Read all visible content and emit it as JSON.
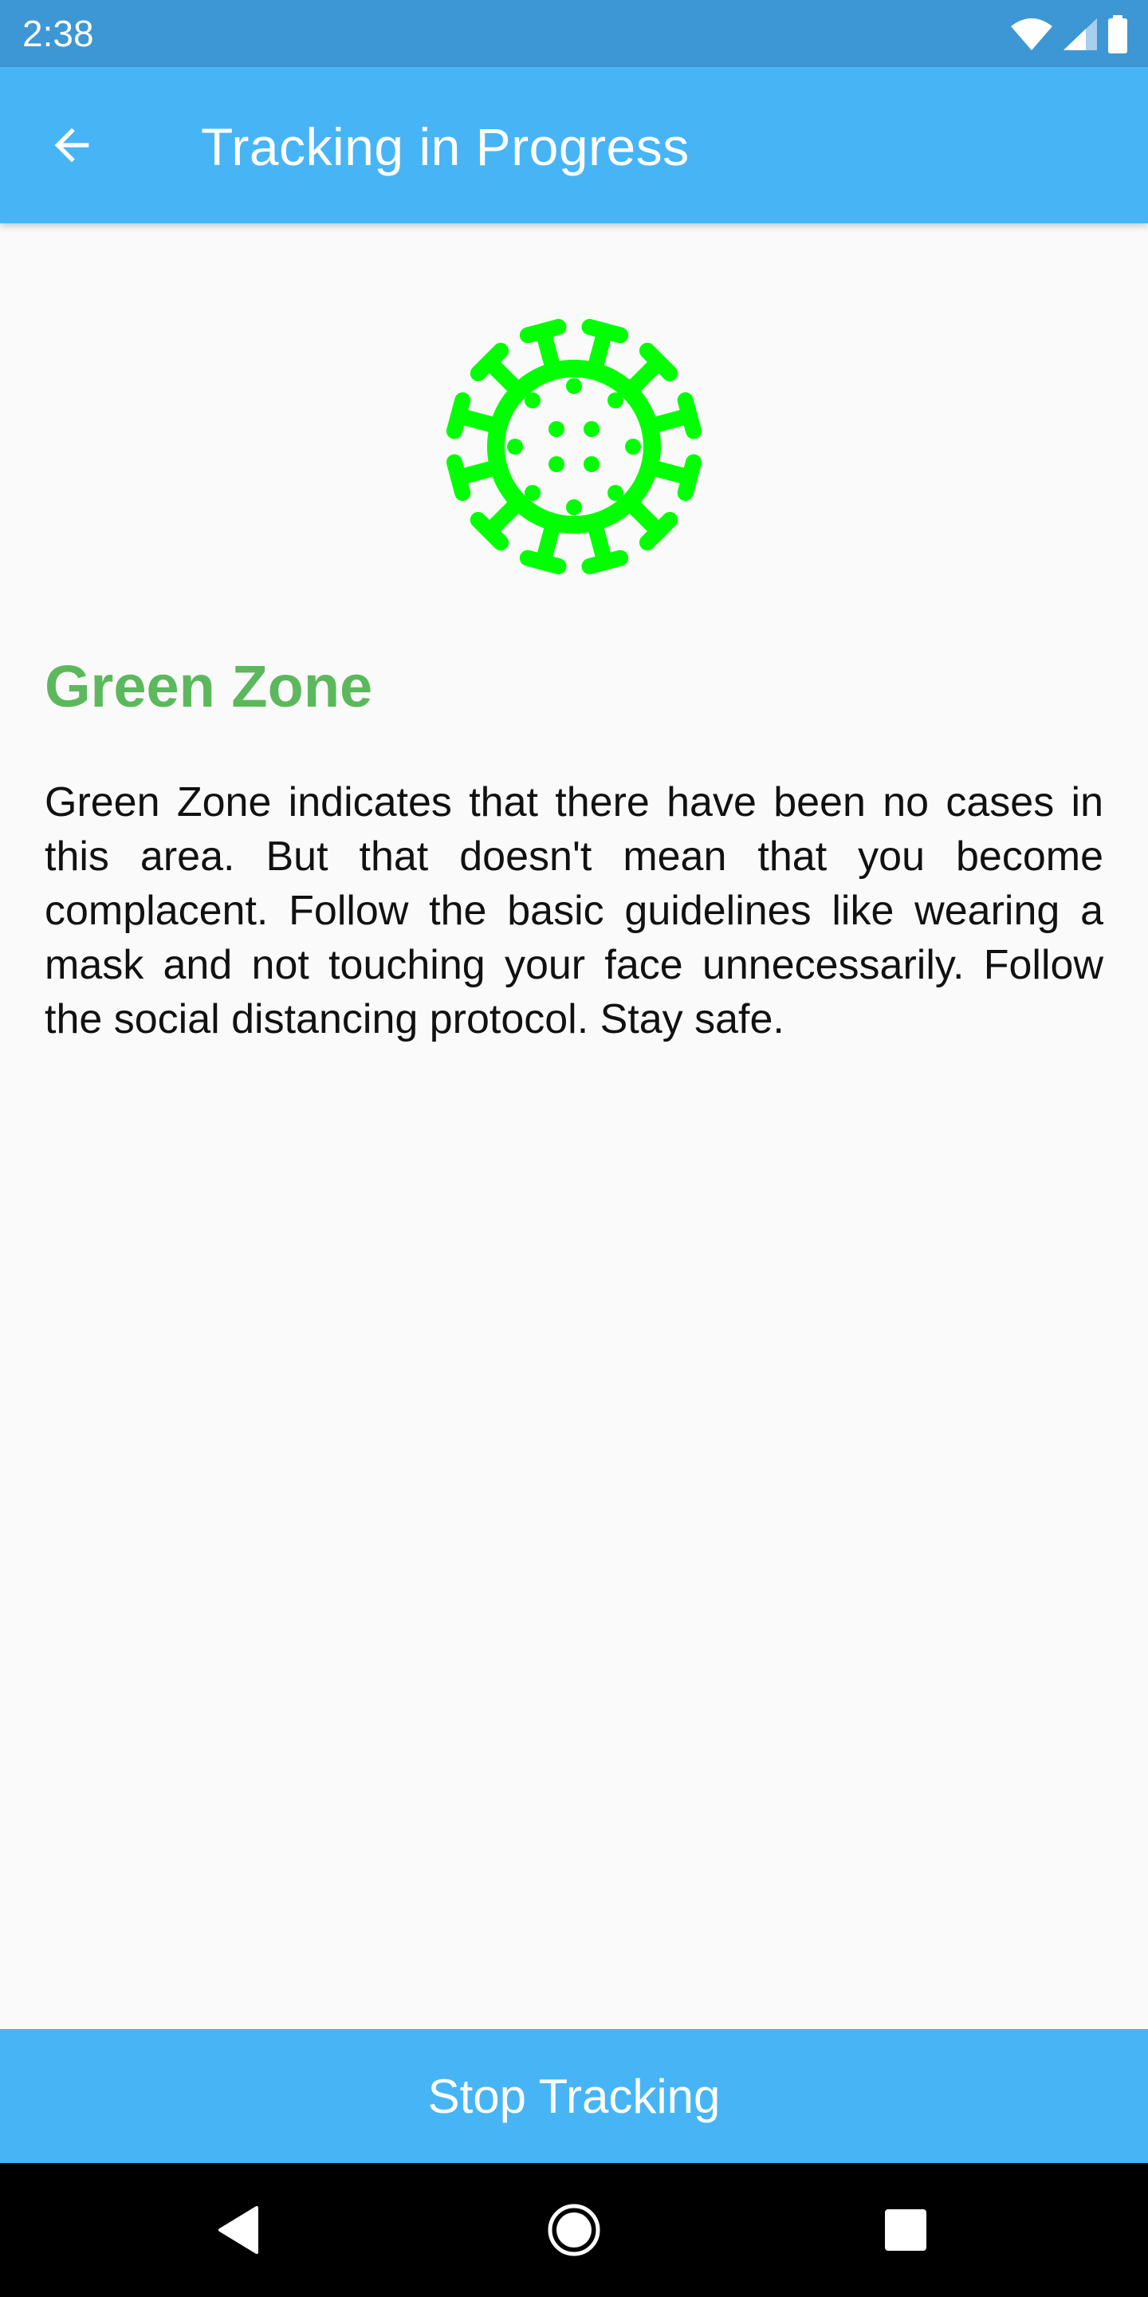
{
  "status_bar": {
    "time": "2:38",
    "icons": [
      "wifi-icon",
      "signal-icon",
      "battery-icon"
    ]
  },
  "app_bar": {
    "back_icon": "arrow-left-icon",
    "title": "Tracking in Progress",
    "background": "#47b5f5"
  },
  "zone": {
    "icon": "virus-icon",
    "icon_color": "#00ff00",
    "title": "Green Zone",
    "title_color": "#5cb85c",
    "description": "Green Zone indicates that there have been no cases in this area. But that doesn't mean that you become complacent. Follow the basic guidelines like wearing a mask and not touching your face unnecessarily. Follow the social distancing protocol. Stay safe."
  },
  "actions": {
    "stop_label": "Stop Tracking"
  },
  "nav_bar": {
    "icons": [
      "back-triangle-icon",
      "home-circle-icon",
      "recents-square-icon"
    ]
  }
}
